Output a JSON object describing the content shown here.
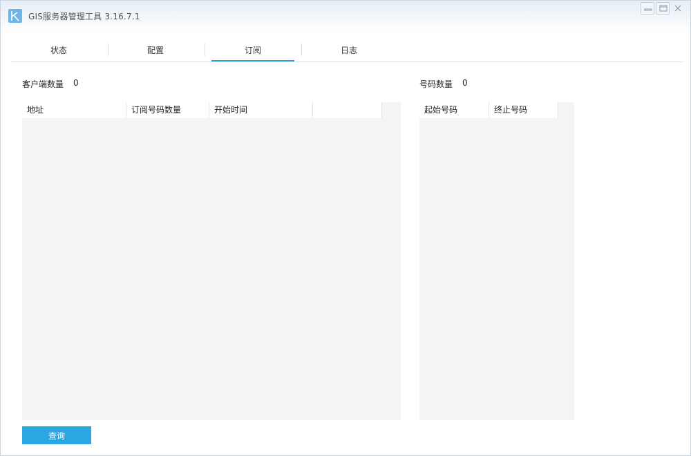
{
  "window": {
    "title": "GIS服务器管理工具 3.16.7.1",
    "controls": [
      "minimize-icon",
      "restore-icon",
      "close-icon"
    ]
  },
  "tabs": [
    {
      "label": "状态",
      "active": false
    },
    {
      "label": "配置",
      "active": false
    },
    {
      "label": "订阅",
      "active": true
    },
    {
      "label": "日志",
      "active": false
    }
  ],
  "left": {
    "count_label": "客户端数量",
    "count_value": "0",
    "columns": [
      "地址",
      "订阅号码数量",
      "开始时间",
      ""
    ],
    "rows": []
  },
  "right": {
    "count_label": "号码数量",
    "count_value": "0",
    "columns": [
      "起始号码",
      "终止号码"
    ],
    "rows": []
  },
  "buttons": {
    "query_label": "查询"
  },
  "colors": {
    "accent": "#2aa6e0",
    "panel_bg": "#f4f4f4",
    "app_icon": "#6fb6e6"
  }
}
